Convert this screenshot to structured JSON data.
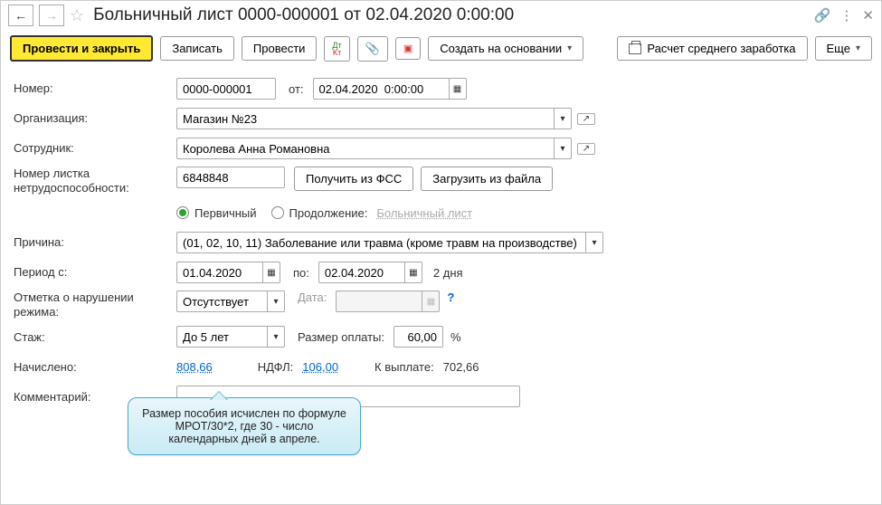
{
  "titlebar": {
    "title": "Больничный лист 0000-000001 от 02.04.2020 0:00:00"
  },
  "toolbar": {
    "primary": "Провести и закрыть",
    "save": "Записать",
    "post": "Провести",
    "dtkt_top": "Дт",
    "dtkt_bot": "Кт",
    "create_based": "Создать на основании",
    "calc_avg": "Расчет среднего заработка",
    "more": "Еще"
  },
  "labels": {
    "number": "Номер:",
    "from": "от:",
    "org": "Организация:",
    "employee": "Сотрудник:",
    "sheet_no": "Номер листка нетрудоспособности:",
    "reason": "Причина:",
    "period_from": "Период с:",
    "period_to": "по:",
    "violation": "Отметка о нарушении режима:",
    "date": "Дата:",
    "seniority": "Стаж:",
    "pay_size": "Размер оплаты:",
    "accrued": "Начислено:",
    "ndfl": "НДФЛ:",
    "to_pay": "К выплате:",
    "comment": "Комментарий:"
  },
  "values": {
    "number": "0000-000001",
    "date": "02.04.2020  0:00:00",
    "org": "Магазин №23",
    "employee": "Королева Анна Романовна",
    "sheet_no": "6848848",
    "btn_fss": "Получить из ФСС",
    "btn_file": "Загрузить из файла",
    "radio_primary": "Первичный",
    "radio_continue": "Продолжение:",
    "continue_link": "Больничный лист",
    "reason": "(01, 02, 10, 11) Заболевание или травма (кроме травм на производстве)",
    "period_from": "01.04.2020",
    "period_to": "02.04.2020",
    "days": "2 дня",
    "violation": "Отсутствует",
    "seniority": "До 5 лет",
    "pay_size": "60,00",
    "pct": "%",
    "accrued": "808,66",
    "ndfl": "106,00",
    "to_pay": "702,66",
    "help": "?"
  },
  "callout": "Размер пособия исчислен по формуле МРОТ/30*2, где 30 - число календарных дней в апреле."
}
